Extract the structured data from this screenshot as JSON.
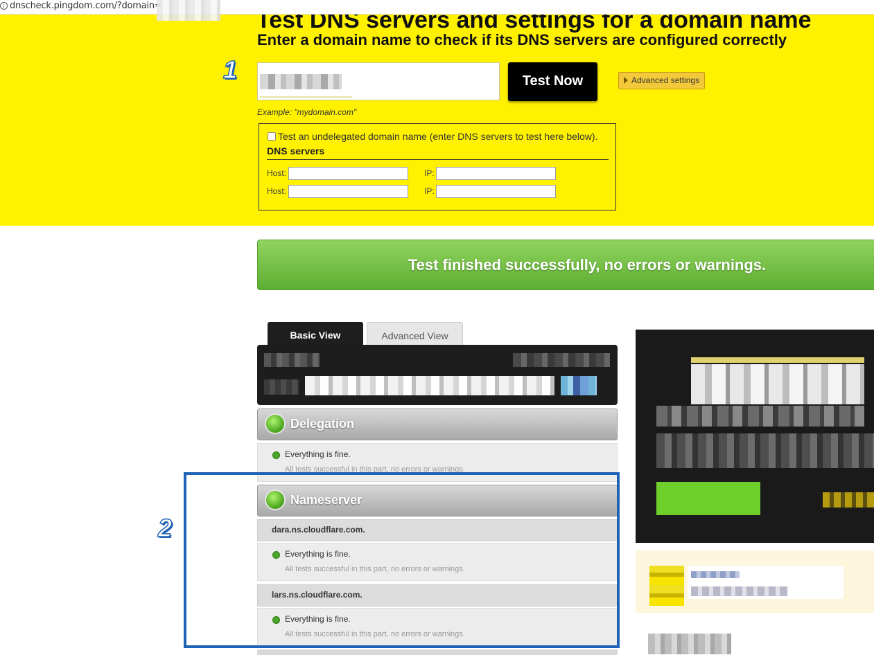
{
  "browser": {
    "url_text": "dnscheck.pingdom.com/?domain=",
    "info_icon": "info-circle-icon"
  },
  "hero": {
    "title": "Test DNS servers and settings for a domain name",
    "subtitle": "Enter a domain name to check if its DNS servers are configured correctly",
    "test_button": "Test Now",
    "advanced_button": "Advanced settings",
    "example": "Example: \"mydomain.com\"",
    "undelegated_label": "Test an undelegated domain name (enter DNS servers to test here below).",
    "undelegated_checked": false,
    "dns_servers_heading": "DNS servers",
    "host_label": "Host:",
    "ip_label": "IP:",
    "colors": {
      "background": "#fff100",
      "button": "#000000",
      "advanced": "#f3c93b"
    }
  },
  "banner": {
    "text": "Test finished successfully, no errors or warnings.",
    "color": "#6cbc3f"
  },
  "tabs": [
    {
      "label": "Basic View",
      "active": true
    },
    {
      "label": "Advanced View",
      "active": false
    }
  ],
  "sections": {
    "delegation": {
      "title": "Delegation",
      "status": "Everything is fine.",
      "detail": "All tests successful in this part, no errors or warnings."
    },
    "nameserver": {
      "title": "Nameserver",
      "servers": [
        {
          "host": "dara.ns.cloudflare.com.",
          "status": "Everything is fine.",
          "detail": "All tests successful in this part, no errors or warnings."
        },
        {
          "host": "lars.ns.cloudflare.com.",
          "status": "Everything is fine.",
          "detail": "All tests successful in this part, no errors or warnings."
        }
      ]
    }
  },
  "annotations": {
    "step1": "1",
    "step2": "2",
    "highlight_color": "#1e63b5"
  }
}
